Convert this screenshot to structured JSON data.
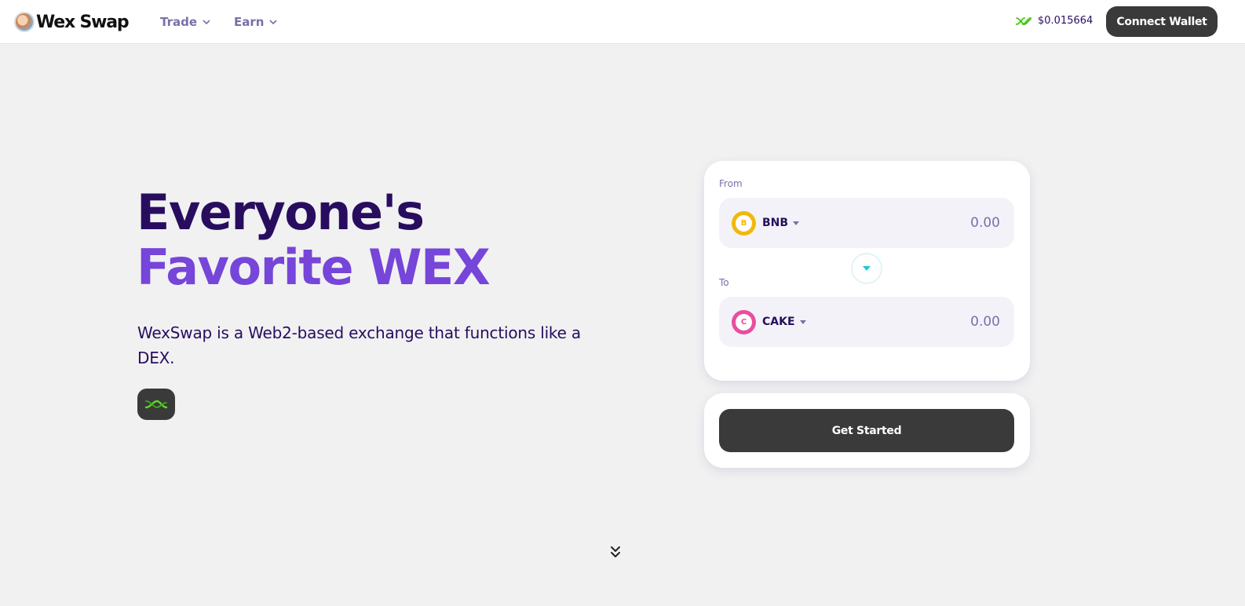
{
  "header": {
    "logo_text": "Wex Swap",
    "nav": [
      {
        "label": "Trade",
        "icon": "chevron-down-icon"
      },
      {
        "label": "Earn",
        "icon": "chevron-down-icon"
      }
    ],
    "token_price": "$0.015664",
    "connect_wallet_label": "Connect Wallet"
  },
  "hero": {
    "title_line1": "Everyone's",
    "title_line2": "Favorite WEX",
    "subtitle": "WexSwap is a Web2-based exchange that functions like a DEX.",
    "icon": "wex-logo-icon"
  },
  "swap": {
    "from_label": "From",
    "from_token": {
      "symbol": "BNB",
      "icon_letter": "B",
      "color": "#f0b90b",
      "amount": "0.00"
    },
    "to_label": "To",
    "to_token": {
      "symbol": "CAKE",
      "icon_letter": "C",
      "color": "#e84f9d",
      "amount": "0.00"
    },
    "cta_label": "Get Started"
  },
  "colors": {
    "primary_text": "#280d5f",
    "accent_purple": "#7645d9",
    "secondary_text": "#7a6eaa",
    "button_dark": "#3a3a3a",
    "wex_green": "#5fd42a",
    "teal": "#1fc7d4"
  }
}
